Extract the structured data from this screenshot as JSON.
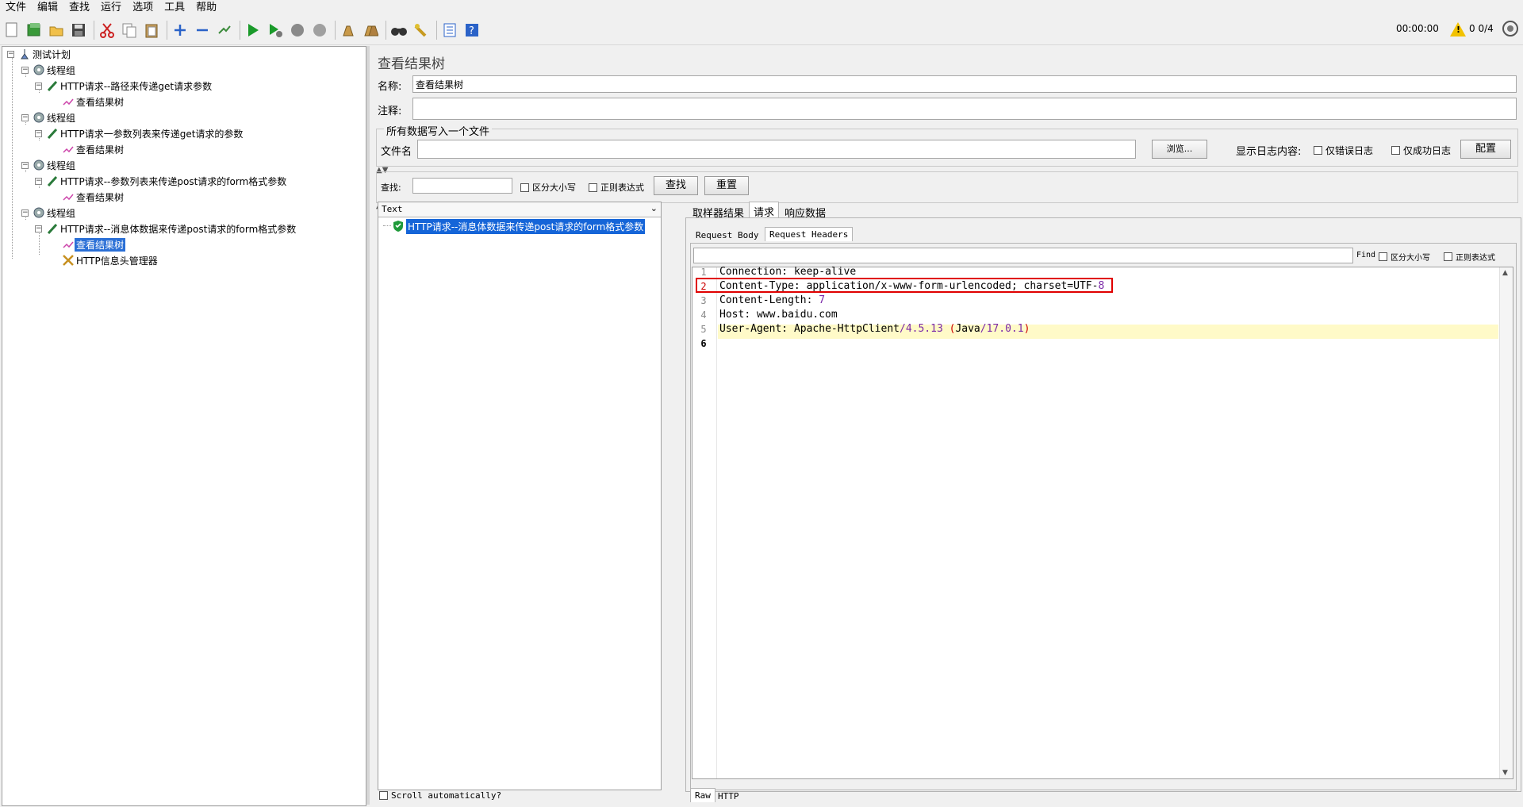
{
  "menu": [
    "文件",
    "编辑",
    "查找",
    "运行",
    "选项",
    "工具",
    "帮助"
  ],
  "toolbar": {
    "icons": [
      "new-icon",
      "templates-icon",
      "open-icon",
      "save-icon",
      "cut-icon",
      "copy-icon",
      "paste-icon",
      "expand-icon",
      "collapse-icon",
      "toggle-icon",
      "start-icon",
      "start-no-pause-icon",
      "stop-icon",
      "shutdown-icon",
      "clear-icon",
      "clear-all-icon",
      "search-icon",
      "reset-search-icon",
      "function-helper-icon",
      "help-icon"
    ],
    "elapsed": "00:00:00",
    "warnings": "0",
    "threads": "0/4"
  },
  "tree": [
    {
      "label": "测试计划"
    },
    {
      "label": "线程组"
    },
    {
      "label": "HTTP请求--路径来传递get请求参数"
    },
    {
      "label": "查看结果树"
    },
    {
      "label": "线程组"
    },
    {
      "label": "HTTP请求一参数列表来传递get请求的参数"
    },
    {
      "label": "查看结果树"
    },
    {
      "label": "线程组"
    },
    {
      "label": "HTTP请求--参数列表来传递post请求的form格式参数"
    },
    {
      "label": "查看结果树"
    },
    {
      "label": "线程组"
    },
    {
      "label": "HTTP请求--消息体数据来传递post请求的form格式参数"
    },
    {
      "label": "查看结果树"
    },
    {
      "label": "HTTP信息头管理器"
    }
  ],
  "panel": {
    "title": "查看结果树",
    "name_label": "名称:",
    "name_value": "查看结果树",
    "comment_label": "注释:",
    "comment_value": "",
    "file_group_title": "所有数据写入一个文件",
    "file_label": "文件名",
    "file_value": "",
    "browse": "浏览...",
    "log_label": "显示日志内容:",
    "errors_only": "仅错误日志",
    "success_only": "仅成功日志",
    "configure": "配置",
    "search_label": "查找:",
    "search_value": "",
    "case_sensitive": "区分大小写",
    "regex": "正则表达式",
    "find_btn": "查找",
    "reset_btn": "重置"
  },
  "results": {
    "renderer": "Text",
    "items": [
      "HTTP请求--消息体数据来传递post请求的form格式参数"
    ],
    "scroll_auto": "Scroll automatically?"
  },
  "detail": {
    "tabs": [
      "取样器结果",
      "请求",
      "响应数据"
    ],
    "active_tab": "请求",
    "subtabs": [
      "Request Body",
      "Request Headers"
    ],
    "active_subtab": "Request Headers",
    "find_label": "Find",
    "find_case": "区分大小写",
    "find_regex": "正则表达式",
    "bottom_tabs": [
      "Raw",
      "HTTP"
    ],
    "lines": [
      {
        "n": "1",
        "k": "Connection",
        "v": "keep-alive"
      },
      {
        "n": "2",
        "k": "Content-Type",
        "v": "application/x-www-form-urlencoded; charset=UTF-",
        "v2": "8"
      },
      {
        "n": "3",
        "k": "Content-Length",
        "v": "",
        "v2": "7"
      },
      {
        "n": "4",
        "k": "Host",
        "v": "www.baidu.com"
      },
      {
        "n": "5",
        "k": "User-Agent",
        "v": "Apache-HttpClient",
        "v2": "/4.5.13 ",
        "v3": "(",
        "v4": "Java",
        "v5": "/17.0.1",
        "v6": ")"
      },
      {
        "n": "6",
        "k": "",
        "v": ""
      }
    ],
    "highlight_color": "#e00000"
  }
}
